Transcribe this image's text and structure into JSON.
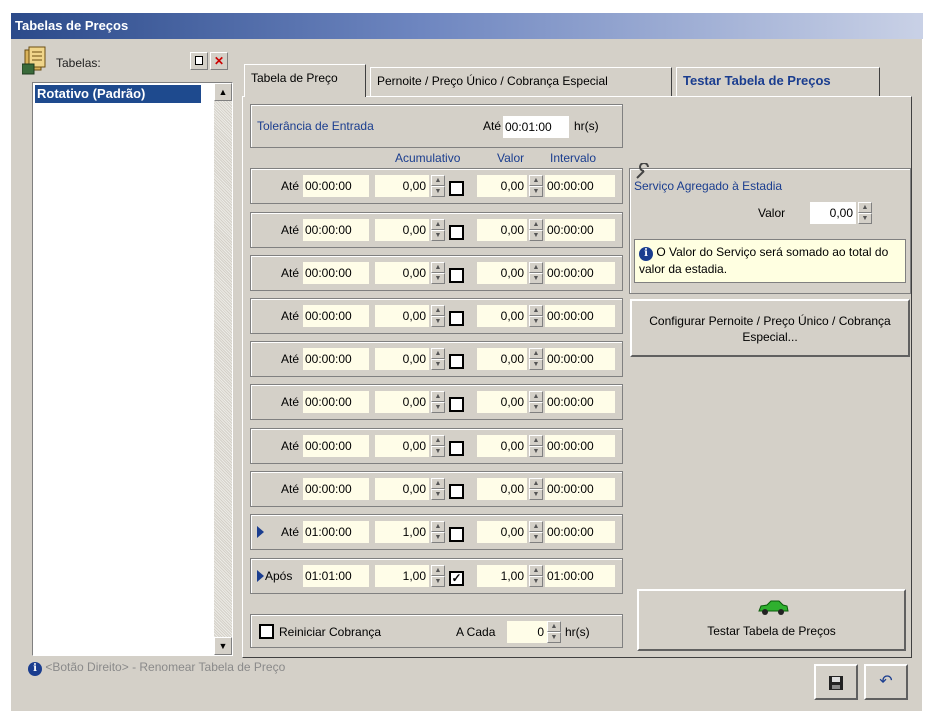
{
  "window": {
    "title": "Tabelas de Preços"
  },
  "tables_panel": {
    "label": "Tabelas:",
    "new_button_icon": "new-document-icon",
    "delete_button_icon": "delete-x-icon",
    "items": [
      {
        "label": "Rotativo (Padrão)",
        "selected": true
      }
    ]
  },
  "tabs": [
    {
      "label": "Tabela de Preço",
      "active": true
    },
    {
      "label": "Pernoite / Preço Único / Cobrança Especial",
      "active": false
    },
    {
      "label": "Testar Tabela de Preços",
      "active": false
    }
  ],
  "tolerance": {
    "label": "Tolerância de Entrada",
    "ate_label": "Até",
    "value": "00:01:00",
    "unit": "hr(s)"
  },
  "column_headers": {
    "acumulativo": "Acumulativo",
    "valor": "Valor",
    "intervalo": "Intervalo"
  },
  "rows": [
    {
      "prefix": "Até",
      "time": "00:00:00",
      "acumulativo": "0,00",
      "checked": false,
      "valor": "0,00",
      "intervalo": "00:00:00",
      "marker": false
    },
    {
      "prefix": "Até",
      "time": "00:00:00",
      "acumulativo": "0,00",
      "checked": false,
      "valor": "0,00",
      "intervalo": "00:00:00",
      "marker": false
    },
    {
      "prefix": "Até",
      "time": "00:00:00",
      "acumulativo": "0,00",
      "checked": false,
      "valor": "0,00",
      "intervalo": "00:00:00",
      "marker": false
    },
    {
      "prefix": "Até",
      "time": "00:00:00",
      "acumulativo": "0,00",
      "checked": false,
      "valor": "0,00",
      "intervalo": "00:00:00",
      "marker": false
    },
    {
      "prefix": "Até",
      "time": "00:00:00",
      "acumulativo": "0,00",
      "checked": false,
      "valor": "0,00",
      "intervalo": "00:00:00",
      "marker": false
    },
    {
      "prefix": "Até",
      "time": "00:00:00",
      "acumulativo": "0,00",
      "checked": false,
      "valor": "0,00",
      "intervalo": "00:00:00",
      "marker": false
    },
    {
      "prefix": "Até",
      "time": "00:00:00",
      "acumulativo": "0,00",
      "checked": false,
      "valor": "0,00",
      "intervalo": "00:00:00",
      "marker": false
    },
    {
      "prefix": "Até",
      "time": "00:00:00",
      "acumulativo": "0,00",
      "checked": false,
      "valor": "0,00",
      "intervalo": "00:00:00",
      "marker": false
    },
    {
      "prefix": "Até",
      "time": "01:00:00",
      "acumulativo": "1,00",
      "checked": false,
      "valor": "0,00",
      "intervalo": "00:00:00",
      "marker": true
    },
    {
      "prefix": "Após",
      "time": "01:01:00",
      "acumulativo": "1,00",
      "checked": true,
      "valor": "1,00",
      "intervalo": "01:00:00",
      "marker": true
    }
  ],
  "reiniciar": {
    "label": "Reiniciar Cobrança",
    "a_cada_label": "A Cada",
    "value": "0",
    "unit": "hr(s)"
  },
  "servico": {
    "title": "Serviço Agregado à Estadia",
    "valor_label": "Valor",
    "valor": "0,00",
    "info_text": "O Valor do Serviço será somado ao total do valor da estadia."
  },
  "configurar_button": "Configurar Pernoite / Preço Único / Cobrança Especial...",
  "testar_button": "Testar Tabela de Preços",
  "status_text": "<Botão Direito> - Renomear Tabela de Preço",
  "icons": {
    "save": "floppy-disk-icon",
    "undo": "undo-icon",
    "wrench": "wrench-icon",
    "car": "car-icon",
    "info": "info-icon",
    "tables": "tables-stack-icon"
  },
  "colors": {
    "title_bar": "#2b4a8a",
    "selection": "#1e4a8e",
    "accent_text": "#1a3d8f",
    "field_bg": "#fffde8"
  }
}
